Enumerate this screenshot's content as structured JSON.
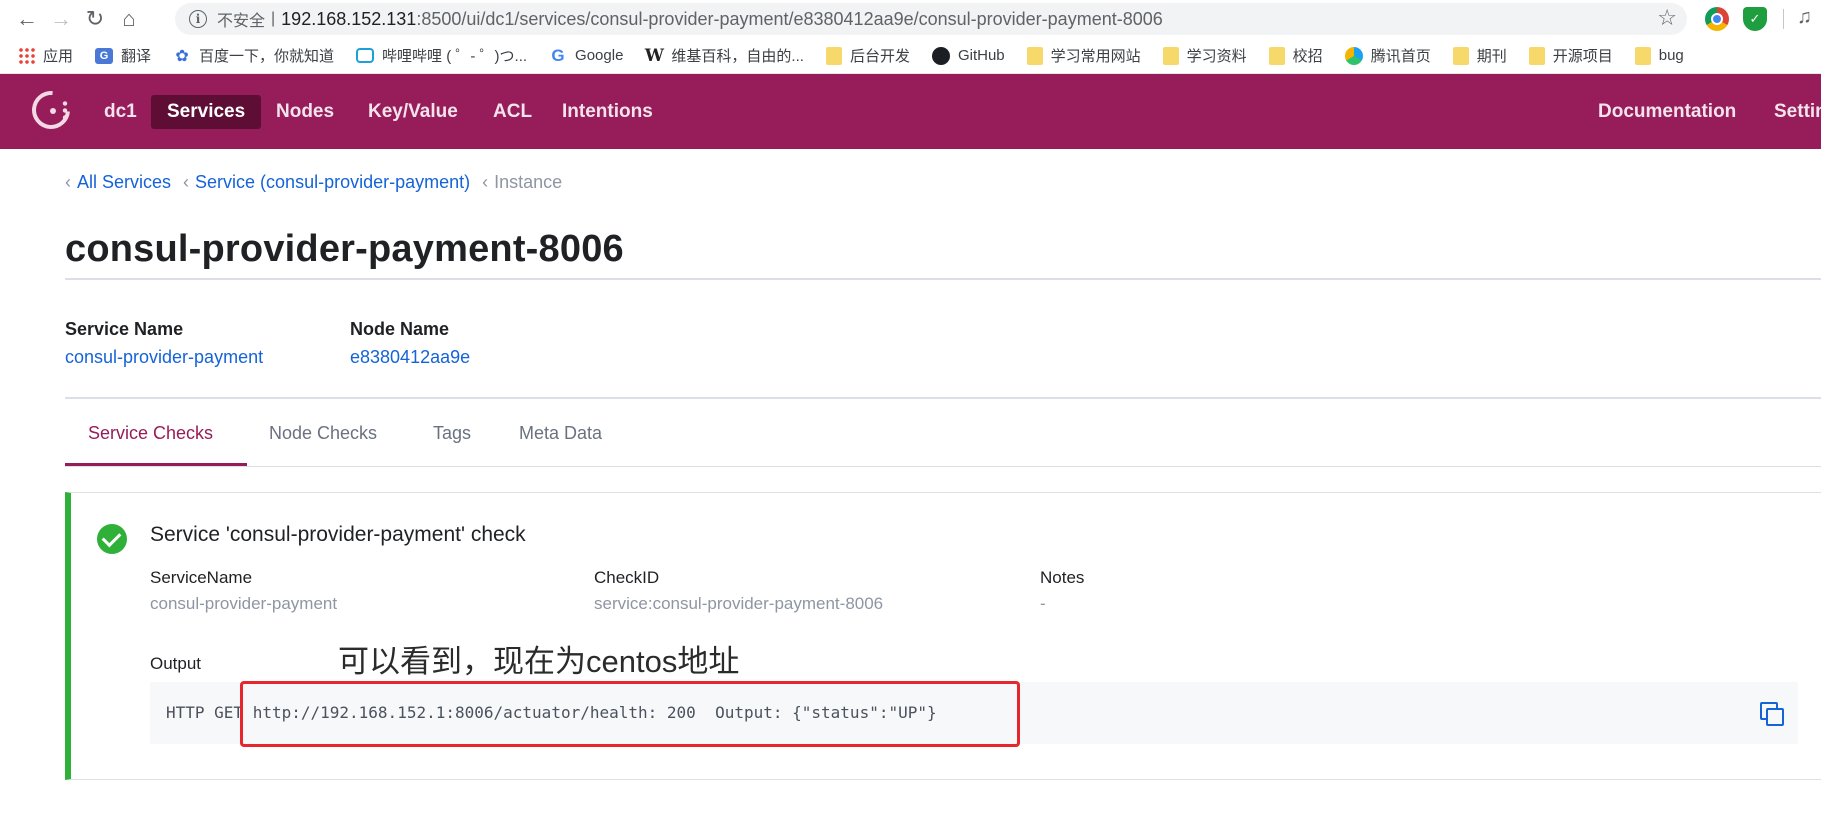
{
  "browser": {
    "insecure_label": "不安全",
    "separator": "|",
    "url_host": "192.168.152.131",
    "url_path": ":8500/ui/dc1/services/consul-provider-payment/e8380412aa9e/consul-provider-payment-8006",
    "nav_icons": [
      "back-arrow",
      "forward-arrow",
      "reload",
      "home"
    ],
    "bookmarks": [
      {
        "label": "应用",
        "icon": "apps-grid"
      },
      {
        "label": "翻译",
        "icon": "translate"
      },
      {
        "label": "百度一下，你就知道",
        "icon": "baidu-paw"
      },
      {
        "label": "哔哩哔哩 ( ゜- ゜)つ...",
        "icon": "bilibili-tv"
      },
      {
        "label": "Google",
        "icon": "google-g"
      },
      {
        "label": "维基百科，自由的...",
        "icon": "wikipedia-w"
      },
      {
        "label": "后台开发",
        "icon": "folder"
      },
      {
        "label": "GitHub",
        "icon": "github"
      },
      {
        "label": "学习常用网站",
        "icon": "folder"
      },
      {
        "label": "学习资料",
        "icon": "folder"
      },
      {
        "label": "校招",
        "icon": "folder"
      },
      {
        "label": "腾讯首页",
        "icon": "qq-browser"
      },
      {
        "label": "期刊",
        "icon": "folder"
      },
      {
        "label": "开源项目",
        "icon": "folder"
      },
      {
        "label": "bug",
        "icon": "folder"
      }
    ]
  },
  "header": {
    "datacenter": "dc1",
    "nav": [
      "Services",
      "Nodes",
      "Key/Value",
      "ACL",
      "Intentions"
    ],
    "active": "Services",
    "right_nav": [
      "Documentation",
      "Settin"
    ],
    "brand_color": "#961d59"
  },
  "breadcrumb": {
    "items": [
      "All Services",
      "Service (consul-provider-payment)"
    ],
    "current": "Instance"
  },
  "page": {
    "title": "consul-provider-payment-8006",
    "service_name_label": "Service Name",
    "service_name": "consul-provider-payment",
    "node_name_label": "Node Name",
    "node_name": "e8380412aa9e"
  },
  "tabs": {
    "items": [
      "Service Checks",
      "Node Checks",
      "Tags",
      "Meta Data"
    ],
    "active": "Service Checks"
  },
  "check": {
    "title": "Service 'consul-provider-payment' check",
    "status": "passing",
    "status_color": "#2eb039",
    "fields": [
      {
        "label": "ServiceName",
        "value": "consul-provider-payment"
      },
      {
        "label": "CheckID",
        "value": "service:consul-provider-payment-8006"
      },
      {
        "label": "Notes",
        "value": "-"
      }
    ],
    "output_label": "Output",
    "output": "HTTP GET http://192.168.152.1:8006/actuator/health: 200  Output: {\"status\":\"UP\"}"
  },
  "annotation": {
    "text": "可以看到，现在为centos地址",
    "box_color": "#e8262e"
  }
}
